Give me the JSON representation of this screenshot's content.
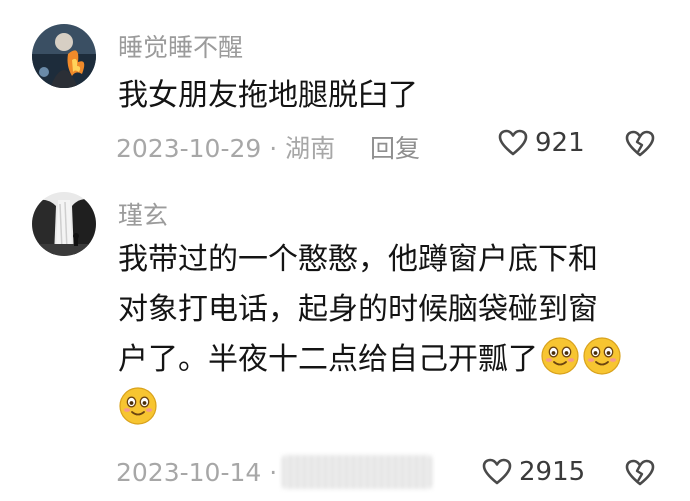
{
  "comments": [
    {
      "username": "睡觉睡不醒",
      "lines": [
        "我女朋友拖地腿脱臼了"
      ],
      "date": "2023-10-29",
      "location": "湖南",
      "reply_label": "回复",
      "likes": "921",
      "avatar_icon": "avatar-photo-fire",
      "emojis": []
    },
    {
      "username": "瑾玄",
      "lines": [
        "我带过的一个憨憨，他蹲窗户底下和",
        "对象打电话，起身的时候脑袋碰到窗",
        "户了。半夜十二点给自己开瓢了"
      ],
      "date": "2023-10-14",
      "location_hidden": true,
      "likes": "2915",
      "avatar_icon": "avatar-photo-waterfall",
      "emojis": [
        "smile-emoji",
        "smile-emoji",
        "smile-emoji"
      ]
    }
  ],
  "separator": " · ",
  "colors": {
    "username": "#9b9b9b",
    "text": "#141414",
    "meta": "#a7a7a7",
    "emoji_yellow": "#f7c531"
  },
  "icons": {
    "like": "heart-outline-icon",
    "dislike": "broken-heart-outline-icon"
  }
}
